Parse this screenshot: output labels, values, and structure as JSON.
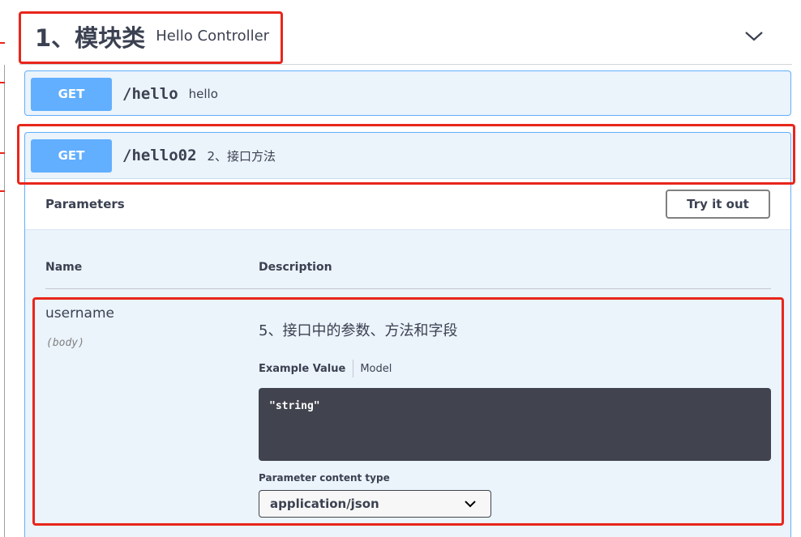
{
  "tag": {
    "name": "1、模块类",
    "description": "Hello Controller"
  },
  "operations": [
    {
      "method": "GET",
      "path": "/hello",
      "summary": "hello"
    },
    {
      "method": "GET",
      "path": "/hello02",
      "summary": "2、接口方法"
    }
  ],
  "params": {
    "title": "Parameters",
    "try_label": "Try it out",
    "col_name": "Name",
    "col_desc": "Description",
    "param_name": "username",
    "param_in": "(body)",
    "param_desc": "5、接口中的参数、方法和字段",
    "tab_example": "Example Value",
    "tab_model": "Model",
    "example_code": "\"string\"",
    "content_type_label": "Parameter content type",
    "content_type_value": "application/json"
  },
  "colors": {
    "get": "#61affe",
    "highlight": "#e8261c",
    "code_bg": "#41444e"
  }
}
